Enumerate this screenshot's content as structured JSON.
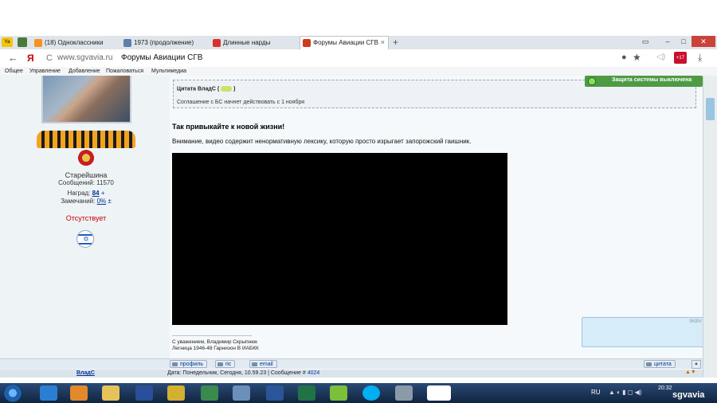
{
  "browser": {
    "tabs": [
      {
        "label": "(18) Одноклассники"
      },
      {
        "label": "1973 (продолжение)"
      },
      {
        "label": "Длинные нарды"
      },
      {
        "label": "Форумы Авиации СГВ"
      }
    ],
    "new_tab": "+",
    "window_buttons": {
      "min": "–",
      "max": "□",
      "close": "✕"
    },
    "back": "←",
    "yandex": "Я",
    "reload": "C",
    "url": "www.sgvavia.ru",
    "page_title": "Форумы Авиации СГВ",
    "protect_badge_text": "Защита системы выключена",
    "bookmarks": [
      "Общее",
      "Управление",
      "Добавление",
      "Пожаловаться",
      "Мультимедиа"
    ],
    "badge_count": "+17"
  },
  "sidebar": {
    "rank": "Старейшина",
    "messages_label": "Сообщений:",
    "messages_value": "11570",
    "awards_label": "Наград:",
    "awards_value": "84",
    "awards_plus": "+",
    "warnings_label": "Замечаний:",
    "warnings_value": "0%",
    "warnings_pm": "±",
    "status": "Отсутствует",
    "author": "ВладС"
  },
  "post": {
    "quote_title": "Цитата ВладС (",
    "quote_title_end": ")",
    "quote_text": "Соглашение с БС начнет действовать с 1 ноября",
    "headline": "Так привыкайте к новой жизни!",
    "warning_text": "Внимание, видео содержит ненормативную лексику, которую просто изрыгает запорожский гаишник.",
    "sig_line1": "С уважением, Владимир Скрыпнюк",
    "sig_line2": "Легница 1946-48 Гарнизон В ИАБКК",
    "buttons": {
      "profile": "профиль",
      "pm": "пс",
      "email": "email",
      "quote": "цитата"
    },
    "date_label": "Дата:",
    "date_value": "Понедельник, Сегодня, 10.59.23",
    "msg_label": "| Сообщение #",
    "msg_number": "4024",
    "popup_label": "SKBV"
  },
  "taskbar": {
    "lang": "RU",
    "time": "20:32",
    "watermark": "sgvavia"
  },
  "colors": {
    "accent_green": "#4caf50",
    "link_blue": "#003399",
    "status_red": "#cc0000"
  }
}
